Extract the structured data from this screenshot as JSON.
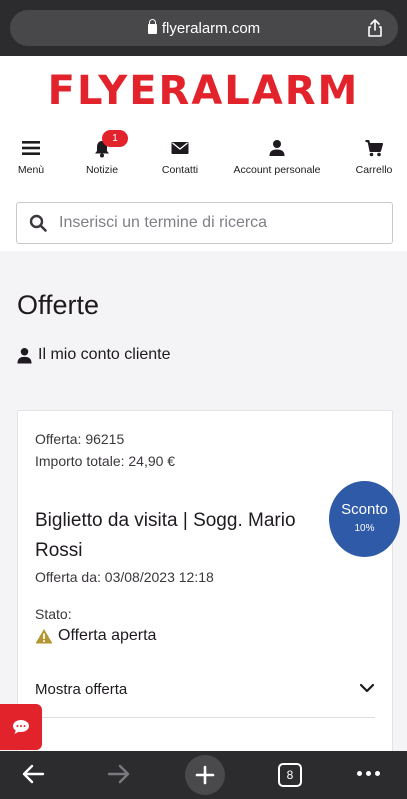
{
  "browser": {
    "url": "flyeralarm.com",
    "tab_count": "8"
  },
  "header": {
    "logo": "FLYERALARM",
    "nav": [
      {
        "label": "Menù",
        "icon": "hamburger-icon"
      },
      {
        "label": "Notizie",
        "icon": "bell-icon",
        "badge": "1"
      },
      {
        "label": "Contatti",
        "icon": "envelope-icon"
      },
      {
        "label": "Account personale",
        "icon": "user-icon"
      },
      {
        "label": "Carrello",
        "icon": "cart-icon"
      }
    ],
    "search_placeholder": "Inserisci un termine di ricerca"
  },
  "main": {
    "title": "Offerte",
    "account_link": "Il mio conto cliente",
    "offer": {
      "number_line": "Offerta: 96215",
      "total_line": "Importo totale: 24,90 €",
      "product": "Biglietto da visita | Sogg. Mario Rossi",
      "date_line": "Offerta da: 03/08/2023 12:18",
      "status_label": "Stato:",
      "status_value": "Offerta aperta",
      "show_label": "Mostra offerta"
    },
    "discount": {
      "title": "Sconto",
      "value": "10%"
    }
  },
  "colors": {
    "brand_red": "#e2232b",
    "discount_blue": "#2e5aa7",
    "warning_gold": "#b39632"
  }
}
